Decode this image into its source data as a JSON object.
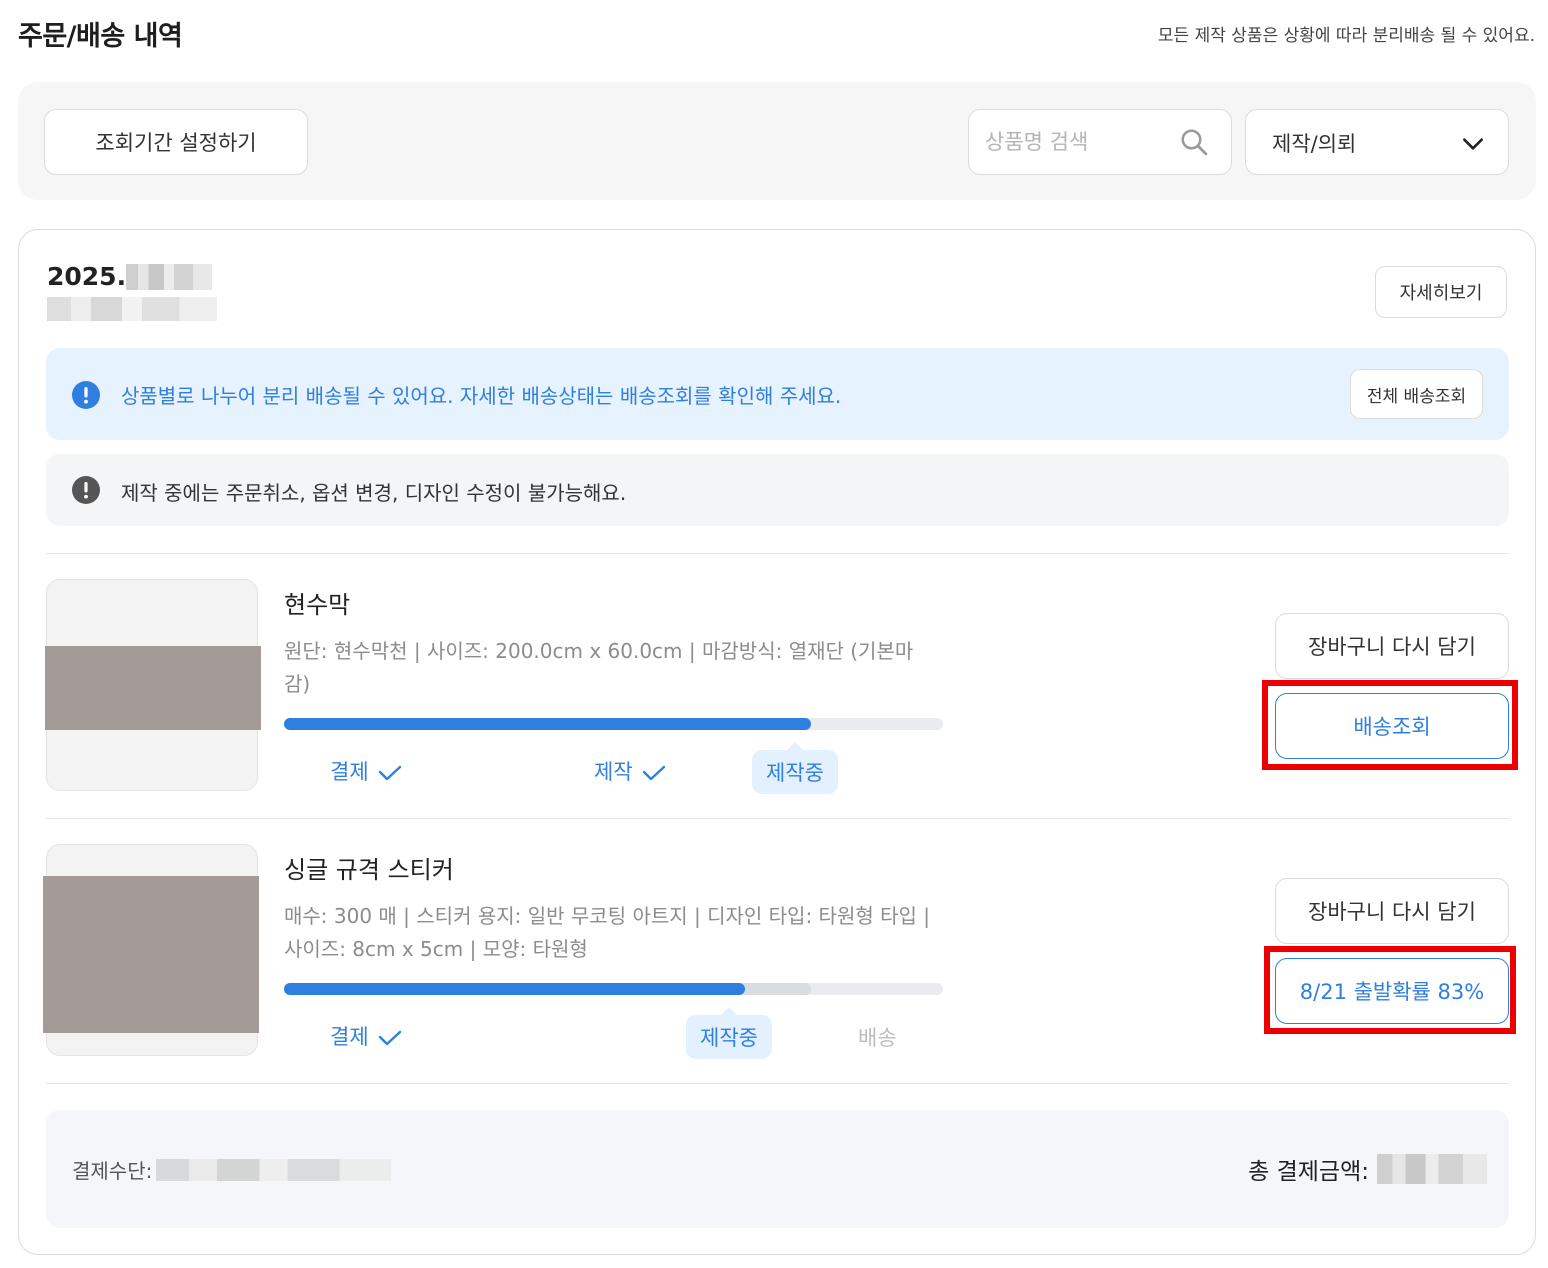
{
  "header": {
    "title": "주문/배송 내역",
    "notice": "모든 제작 상품은 상황에 따라 분리배송 될 수 있어요."
  },
  "filters": {
    "period_button": "조회기간 설정하기",
    "search_placeholder": "상품명 검색",
    "category_selected": "제작/의뢰"
  },
  "order": {
    "date_prefix": "2025.",
    "detail_button": "자세히보기",
    "notice_blue": "상품별로 나누어 분리 배송될 수 있어요. 자세한 배송상태는 배송조회를 확인해 주세요.",
    "track_all_button": "전체 배송조회",
    "notice_gray": "제작 중에는 주문취소, 옵션 변경, 디자인 수정이 불가능해요.",
    "items": [
      {
        "name": "현수막",
        "options": "원단: 현수막천 | 사이즈: 200.0cm x 60.0cm | 마감방식: 열재단 (기본마감)",
        "progress": 0.8,
        "steps": [
          "결제",
          "제작",
          "제작중"
        ],
        "recart_button": "장바구니 다시 담기",
        "track_button": "배송조회"
      },
      {
        "name": "싱글 규격 스티커",
        "options": "매수: 300 매 | 스티커 용지: 일반 무코팅 아트지 | 디자인 타입: 타원형 타입 | 사이즈: 8cm x 5cm | 모양: 타원형",
        "progress": 0.7,
        "progress_secondary": 0.8,
        "steps": [
          "결제",
          "제작중",
          "배송"
        ],
        "recart_button": "장바구니 다시 담기",
        "track_button": "8/21 출발확률 83%"
      }
    ],
    "payment_method_label": "결제수단:",
    "total_label": "총 결제금액:"
  },
  "colors": {
    "accent": "#2f7fe0",
    "highlight": "#ee0000",
    "progress_secondary": "#d9dce1"
  }
}
